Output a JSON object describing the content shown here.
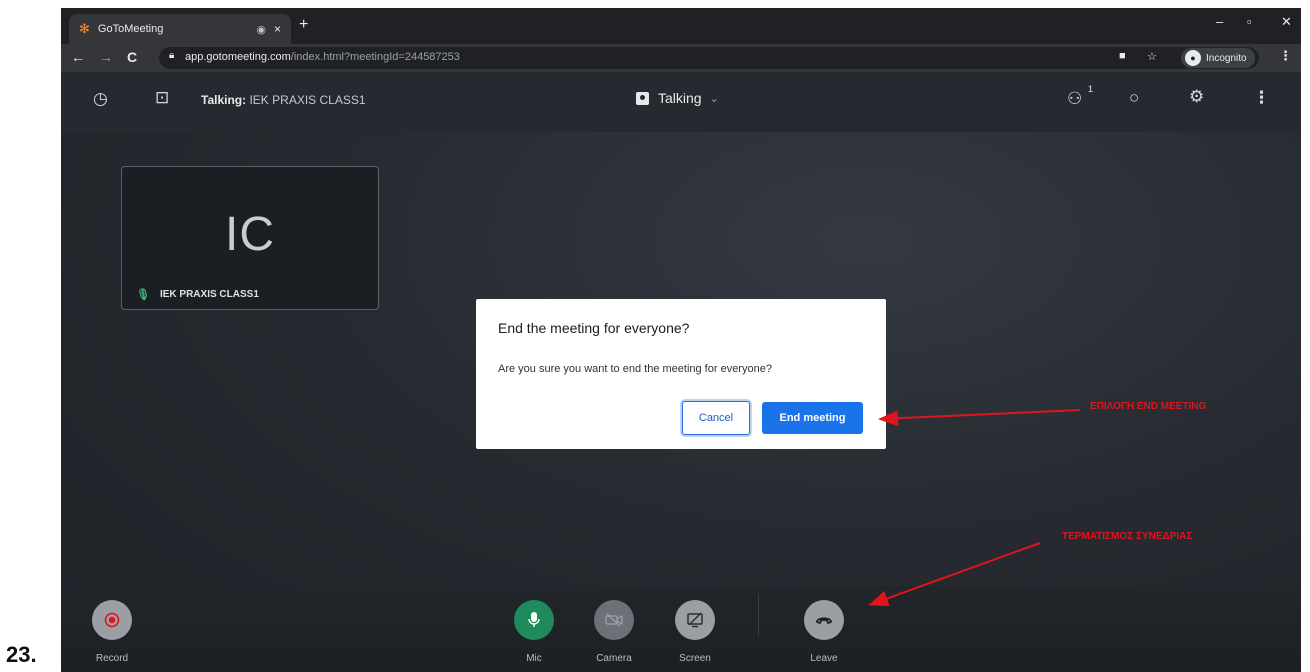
{
  "step_number": "23.",
  "browser": {
    "tab_title": "GoToMeeting",
    "tab_close": "×",
    "new_tab": "+",
    "window_controls": {
      "minimize": "–",
      "maximize": "▫",
      "close": "✕"
    },
    "nav": {
      "back": "←",
      "forward": "→",
      "reload": "C"
    },
    "url_host": "app.gotomeeting.com",
    "url_path": "/index.html?meetingId=244587253",
    "incognito_label": "Incognito"
  },
  "meeting_bar": {
    "talking_prefix": "Talking:",
    "talking_name": "IEK PRAXIS CLASS1",
    "view_mode": "Talking",
    "participant_count": "1"
  },
  "tile": {
    "initials": "IC",
    "name": "IEK PRAXIS CLASS1"
  },
  "dialog": {
    "title": "End the meeting for everyone?",
    "body": "Are you sure you want to end the meeting for everyone?",
    "cancel_label": "Cancel",
    "end_label": "End meeting"
  },
  "controls": {
    "record": "Record",
    "mic": "Mic",
    "camera": "Camera",
    "screen": "Screen",
    "leave": "Leave"
  },
  "annotations": {
    "end_meeting_note": "ΕΠΙΛΟΓΗ END MEETING",
    "leave_note": "ΤΕΡΜΑΤΙΣΜΟΣ ΣΥΝΕΔΡΙΑΣ"
  },
  "colors": {
    "accent_blue": "#1a73e8",
    "mic_green": "#1f8a5b",
    "record_red": "#e0141c",
    "annotation_red": "#e0141c"
  }
}
